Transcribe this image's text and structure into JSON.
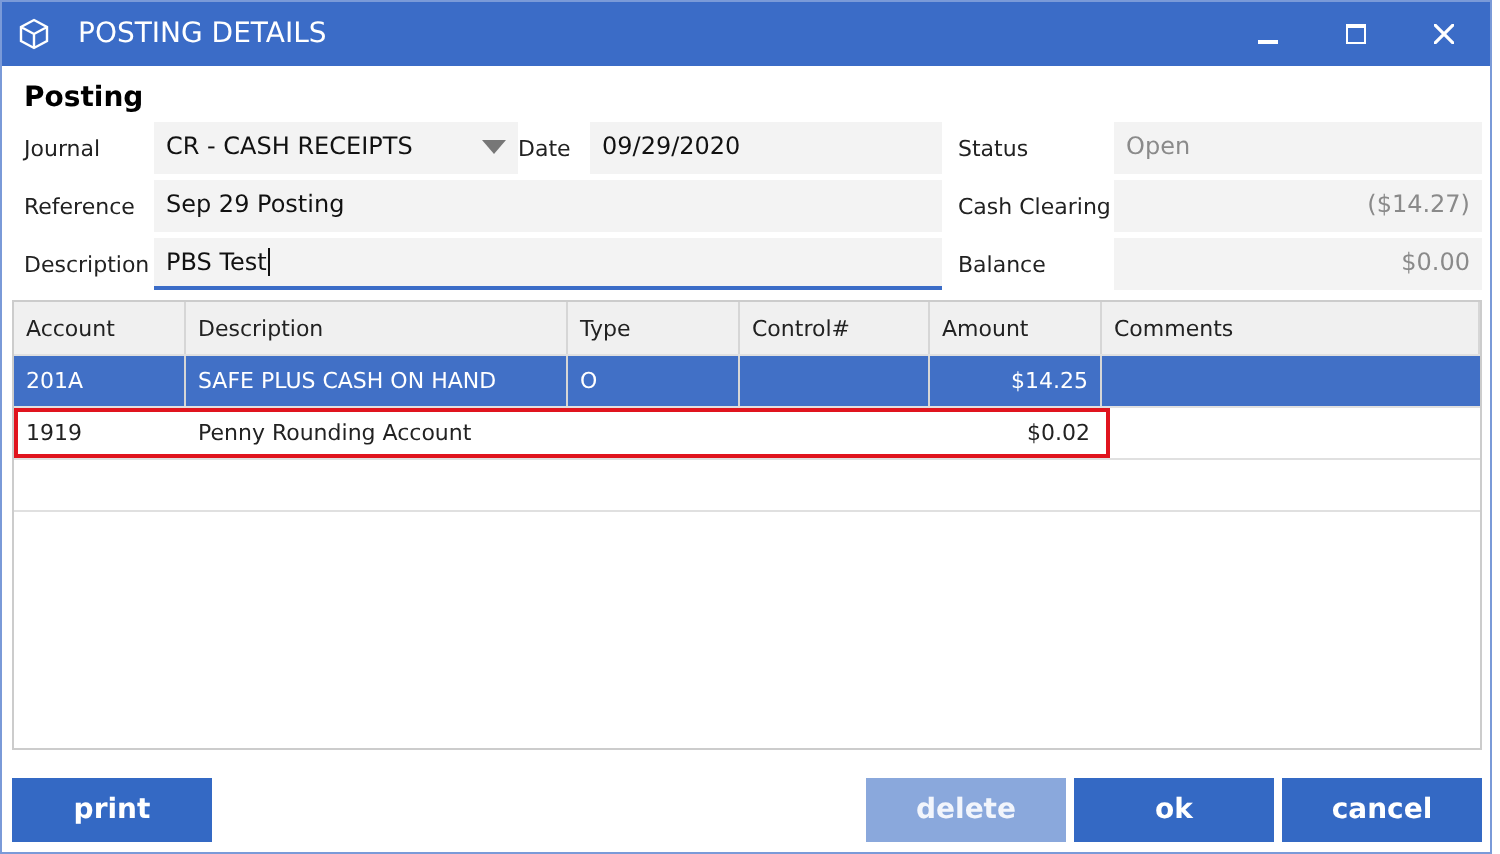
{
  "window": {
    "title": "POSTING DETAILS"
  },
  "section_title": "Posting",
  "fields": [
    {
      "label": "Journal",
      "kind": "dropdown",
      "value": "CR - CASH RECEIPTS"
    },
    {
      "label": "Date",
      "kind": "text",
      "value": "09/29/2020",
      "focused": false
    },
    {
      "label": "Reference",
      "kind": "text",
      "value": "Sep 29 Posting",
      "focused": false
    },
    {
      "label": "Description",
      "kind": "text",
      "value": "PBS Test",
      "focused": true
    }
  ],
  "summary": [
    {
      "label": "Status",
      "kind": "text",
      "value": "Open"
    },
    {
      "label": "Cash Clearing",
      "kind": "amount",
      "value": "($14.27)"
    },
    {
      "label": "Balance",
      "kind": "amount",
      "value": "$0.00"
    }
  ],
  "table": {
    "columns": [
      "Account",
      "Description",
      "Type",
      "Control#",
      "Amount",
      "Comments"
    ],
    "rows": [
      {
        "cells": [
          "201A",
          "SAFE PLUS CASH ON HAND",
          "O",
          "",
          "$14.25",
          ""
        ],
        "selected": true,
        "highlighted": false
      },
      {
        "cells": [
          "1919",
          "Penny Rounding Account",
          "",
          "",
          "$0.02",
          ""
        ],
        "selected": false,
        "highlighted": true
      }
    ]
  },
  "buttons": [
    {
      "label": "print",
      "disabled": false
    },
    {
      "label": "delete",
      "disabled": true
    },
    {
      "label": "ok",
      "disabled": false
    },
    {
      "label": "cancel",
      "disabled": false
    }
  ]
}
